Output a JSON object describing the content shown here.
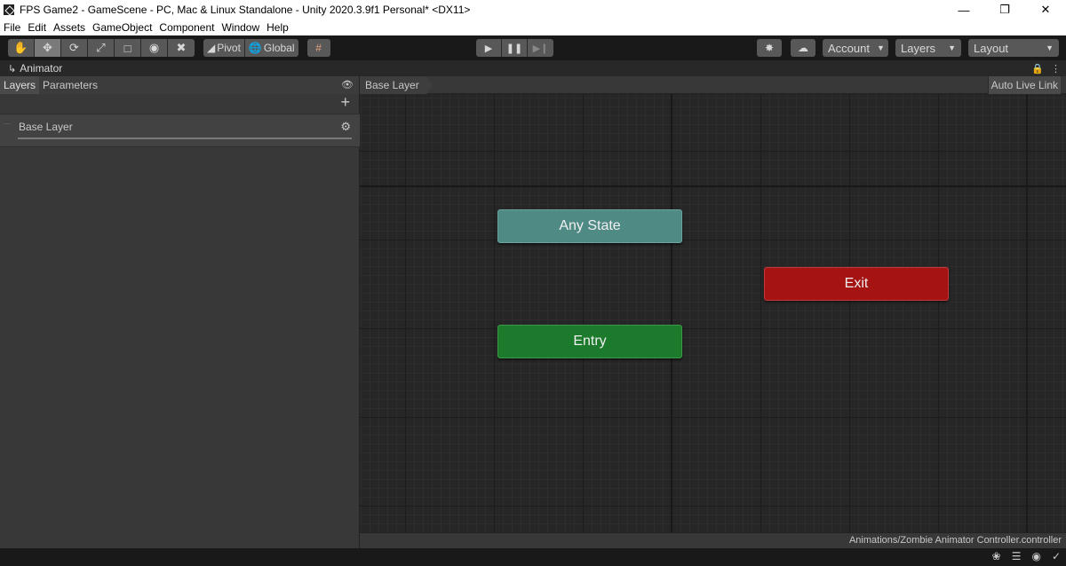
{
  "window": {
    "title": "FPS Game2 - GameScene - PC, Mac & Linux Standalone - Unity 2020.3.9f1 Personal* <DX11>",
    "minimize": "—",
    "maximize": "❐",
    "close": "✕"
  },
  "menu": [
    "File",
    "Edit",
    "Assets",
    "GameObject",
    "Component",
    "Window",
    "Help"
  ],
  "toolbar": {
    "pivot_label": "Pivot",
    "global_label": "Global",
    "account_label": "Account",
    "layers_label": "Layers",
    "layout_label": "Layout"
  },
  "animator": {
    "tab_label": "Animator",
    "left_tabs": [
      "Layers",
      "Parameters"
    ],
    "layer_name": "Base Layer",
    "breadcrumb": "Base Layer",
    "auto_live_link": "Auto Live Link",
    "nodes": {
      "any_state": "Any State",
      "exit": "Exit",
      "entry": "Entry"
    },
    "controller_path": "Animations/Zombie Animator Controller.controller"
  }
}
